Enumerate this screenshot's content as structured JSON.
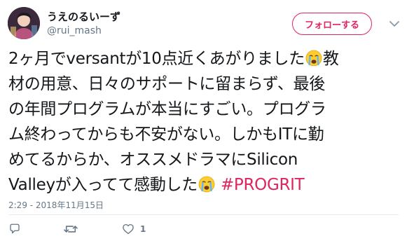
{
  "user": {
    "display_name": "うえのるいーず",
    "handle": "@rui_mash"
  },
  "follow_button": {
    "label": "フォローする"
  },
  "tweet": {
    "lines": [
      {
        "text": "2ヶ月でversantが10点近くあがりました",
        "emoji_after": "crying-face-emoji",
        "text_after": "教"
      },
      {
        "text": "材の用意、日々のサポートに留まらず、最後"
      },
      {
        "text": "の年間プログラムが本当にすごい。プログラ"
      },
      {
        "text": "ム終わってからも不安がない。しかもITに勤"
      },
      {
        "text": "めてるからか、オススメドラマにSilicon"
      },
      {
        "text": "Valleyが入ってて感動した",
        "emoji_after": "crying-face-emoji",
        "hashtag": "#PROGRIT"
      }
    ]
  },
  "timestamp": "2:29 - 2018年11月15日",
  "actions": {
    "reply_icon": "reply-icon",
    "retweet_icon": "retweet-icon",
    "like_icon": "heart-icon",
    "like_count": "1"
  },
  "colors": {
    "accent": "#e0245e",
    "text": "#14171a",
    "muted": "#657786",
    "divider": "#e6ecf0"
  }
}
